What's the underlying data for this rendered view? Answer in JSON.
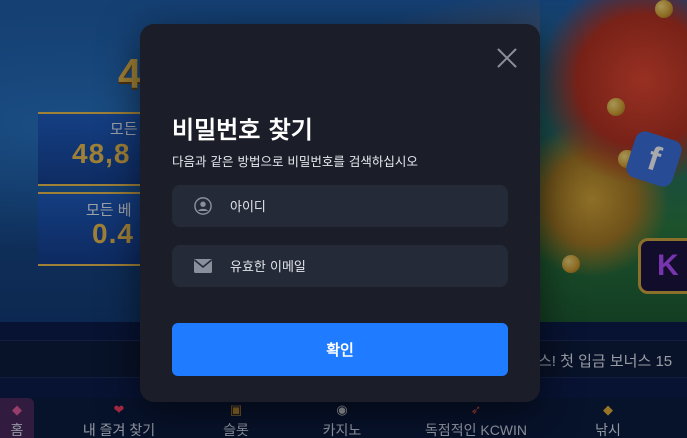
{
  "background": {
    "big_digit": "4",
    "stat_1": {
      "label": "모든",
      "value": "48,8"
    },
    "stat_2": {
      "label": "모든 베",
      "value": "0.4"
    },
    "right_badge": "f",
    "kc_badge": "K",
    "marquee_text": "스! 첫 입금 보너스 15"
  },
  "bottom_nav": {
    "items": [
      {
        "label": "내 즐겨 찾기",
        "icon": "heart-icon",
        "glyph": "❤"
      },
      {
        "label": "슬롯",
        "icon": "slot-machine-icon",
        "glyph": "🎰"
      },
      {
        "label": "카지노",
        "icon": "roulette-icon",
        "glyph": "◉"
      },
      {
        "label": "독점적인 KCWIN",
        "icon": "rocket-icon",
        "glyph": "🚀"
      },
      {
        "label": "낚시",
        "icon": "fish-icon",
        "glyph": "◆"
      }
    ],
    "left_partial_label": "홈"
  },
  "modal": {
    "title": "비밀번호 찾기",
    "subtitle": "다음과 같은 방법으로 비밀번호를 검색하십시오",
    "id_field": {
      "placeholder": "아이디",
      "value": ""
    },
    "email_field": {
      "placeholder": "유효한 이메일",
      "value": ""
    },
    "confirm_label": "확인"
  },
  "colors": {
    "modal_bg": "#1b1e28",
    "field_bg": "#252a38",
    "primary": "#1f7bff"
  }
}
